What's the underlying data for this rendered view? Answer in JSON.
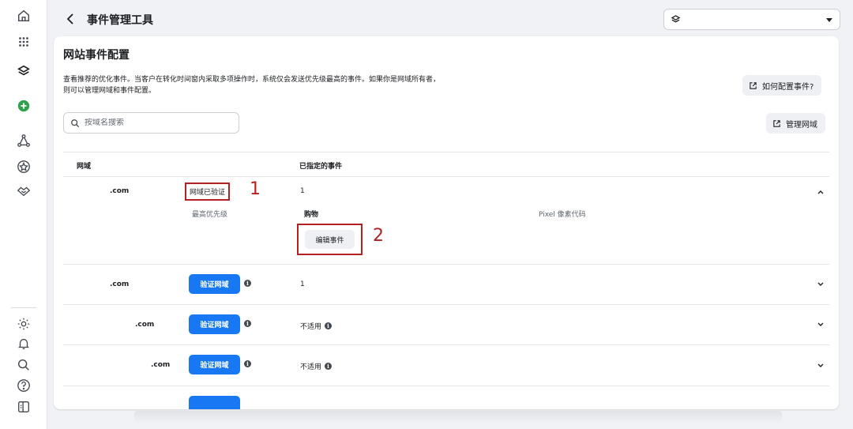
{
  "header": {
    "title": "事件管理工具",
    "account_select_value": ""
  },
  "page": {
    "title": "网站事件配置",
    "description_line1": "查看推荐的优化事件。当客户在转化时间窗内采取多项操作时，系统仅会发送优先级最高的事件。如果你是网域所有者，",
    "description_line2": "则可以管理网域和事件配置。",
    "how_to_button": "如何配置事件?",
    "manage_domains_button": "管理网域",
    "search_placeholder": "按域名搜索"
  },
  "table": {
    "col_domain": "网域",
    "col_events": "已指定的事件",
    "rows": [
      {
        "domain": ".com",
        "status": "网域已验证",
        "events": "1",
        "priority_label": "最高优先级",
        "event_name": "购物",
        "event_source": "Pixel 像素代码",
        "edit_button": "编辑事件"
      },
      {
        "domain": ".com",
        "status": "验证网域",
        "events": "1"
      },
      {
        "domain": ".com",
        "status": "验证网域",
        "events": "不适用"
      },
      {
        "domain": ".com",
        "status": "验证网域",
        "events": "不适用"
      }
    ]
  },
  "annotations": {
    "one": "1",
    "two": "2"
  },
  "colors": {
    "primary": "#1877f2",
    "annotation": "#b22222",
    "background": "#f0f2f5"
  },
  "icons": [
    "home-icon",
    "apps-grid-icon",
    "events-manager-icon",
    "add-circle-icon",
    "graph-icon",
    "star-badge-icon",
    "handshake-icon",
    "settings-icon",
    "bell-icon",
    "search-icon",
    "help-icon",
    "sidebar-toggle-icon"
  ]
}
